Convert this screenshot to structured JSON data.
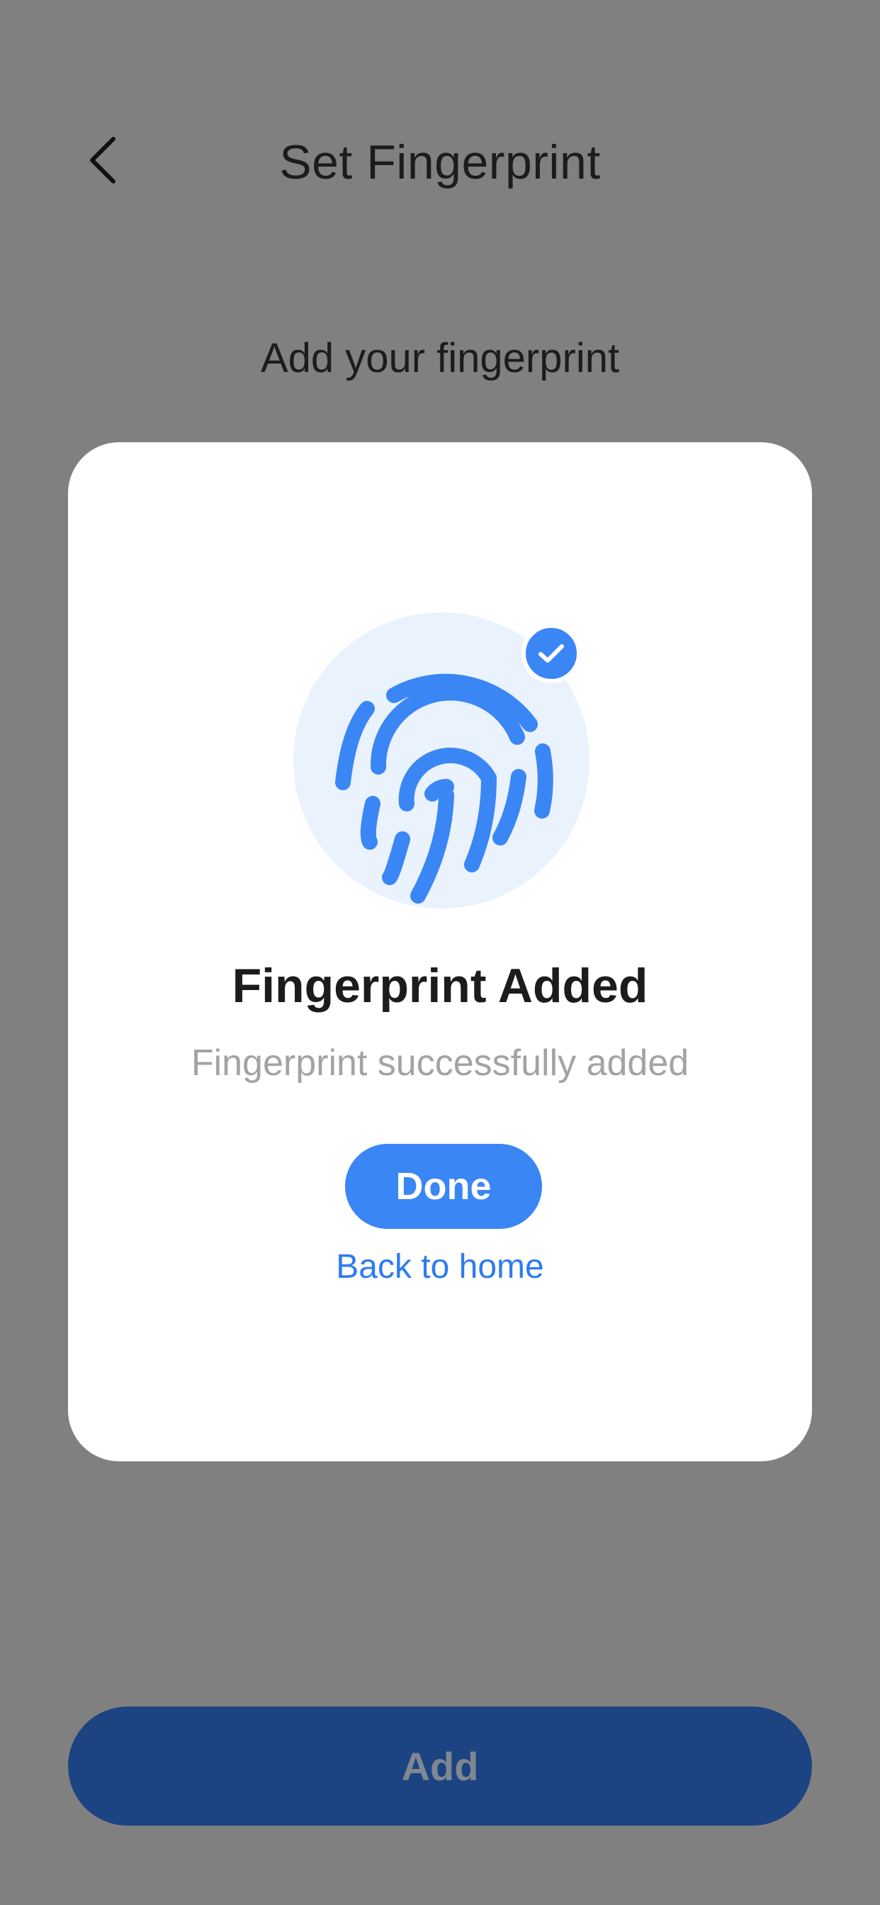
{
  "header": {
    "back_icon": "chevron-left-icon",
    "title": "Set Fingerprint"
  },
  "instruction": "Add your fingerprint",
  "modal": {
    "icon": "fingerprint-icon",
    "badge_icon": "check-icon",
    "title": "Fingerprint Added",
    "subtitle": "Fingerprint successfully added",
    "done_label": "Done",
    "home_link_label": "Back to home"
  },
  "footer": {
    "add_label": "Add"
  },
  "colors": {
    "overlay_background": "#808080",
    "accent": "#3a86f5",
    "icon_circle": "#eaf2fd",
    "add_button_dimmed": "#1c4382"
  }
}
